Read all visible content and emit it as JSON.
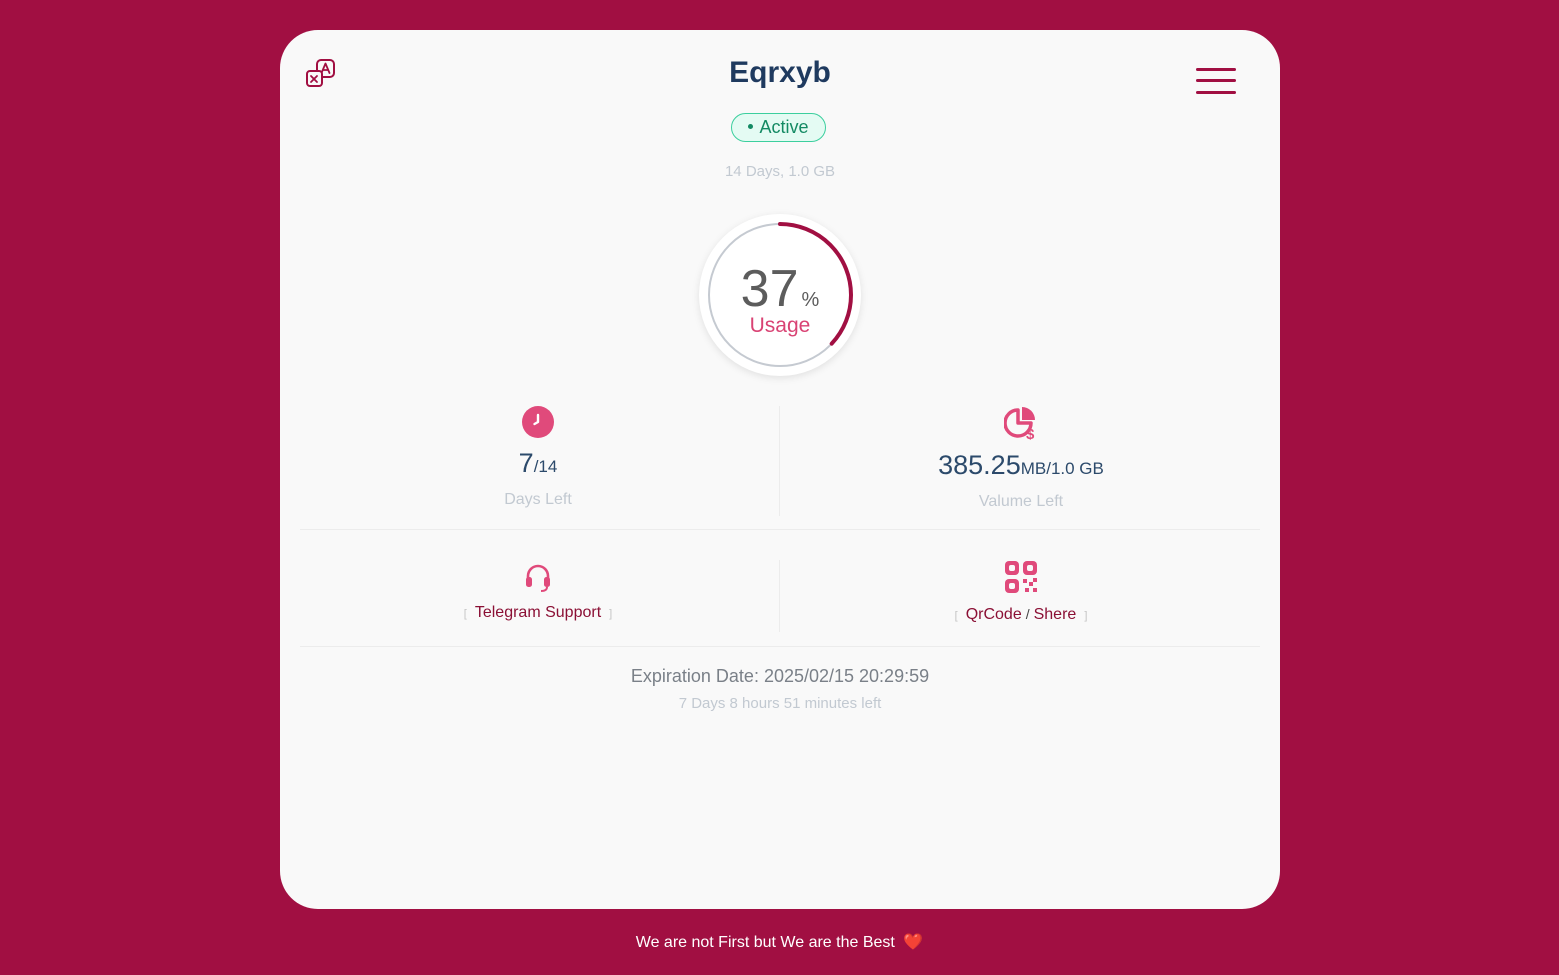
{
  "header": {
    "title": "Eqrxyb",
    "status": "Active",
    "plan": "14 Days, 1.0 GB",
    "translate_icon": "translate-icon",
    "menu_icon": "hamburger-menu-icon"
  },
  "usage": {
    "percent": 37,
    "percent_text": "37",
    "percent_symbol": "%",
    "label": "Usage"
  },
  "days": {
    "icon": "clock-icon",
    "value": "7",
    "total": "/14",
    "label": "Days Left"
  },
  "volume": {
    "icon": "pie-chart-dollar-icon",
    "value": "385.25",
    "unit": "MB/1.0 GB",
    "label": "Valume Left"
  },
  "actions": {
    "support": {
      "icon": "headset-icon",
      "label": "Telegram Support"
    },
    "qrcode": {
      "icon": "qrcode-icon",
      "label": "QrCode",
      "separator": "/",
      "share_label": "Shere"
    }
  },
  "expiration": {
    "date_text": "Expiration Date: 2025/02/15 20:29:59",
    "remaining_text": "7 Days 8 hours 51 minutes left"
  },
  "footer": {
    "text": "We are not First but We are the Best",
    "emoji": "❤️"
  },
  "colors": {
    "background": "#a10f42",
    "accent_pink": "#e04a7b",
    "status_green": "#138a63",
    "title": "#1f3a5f"
  }
}
